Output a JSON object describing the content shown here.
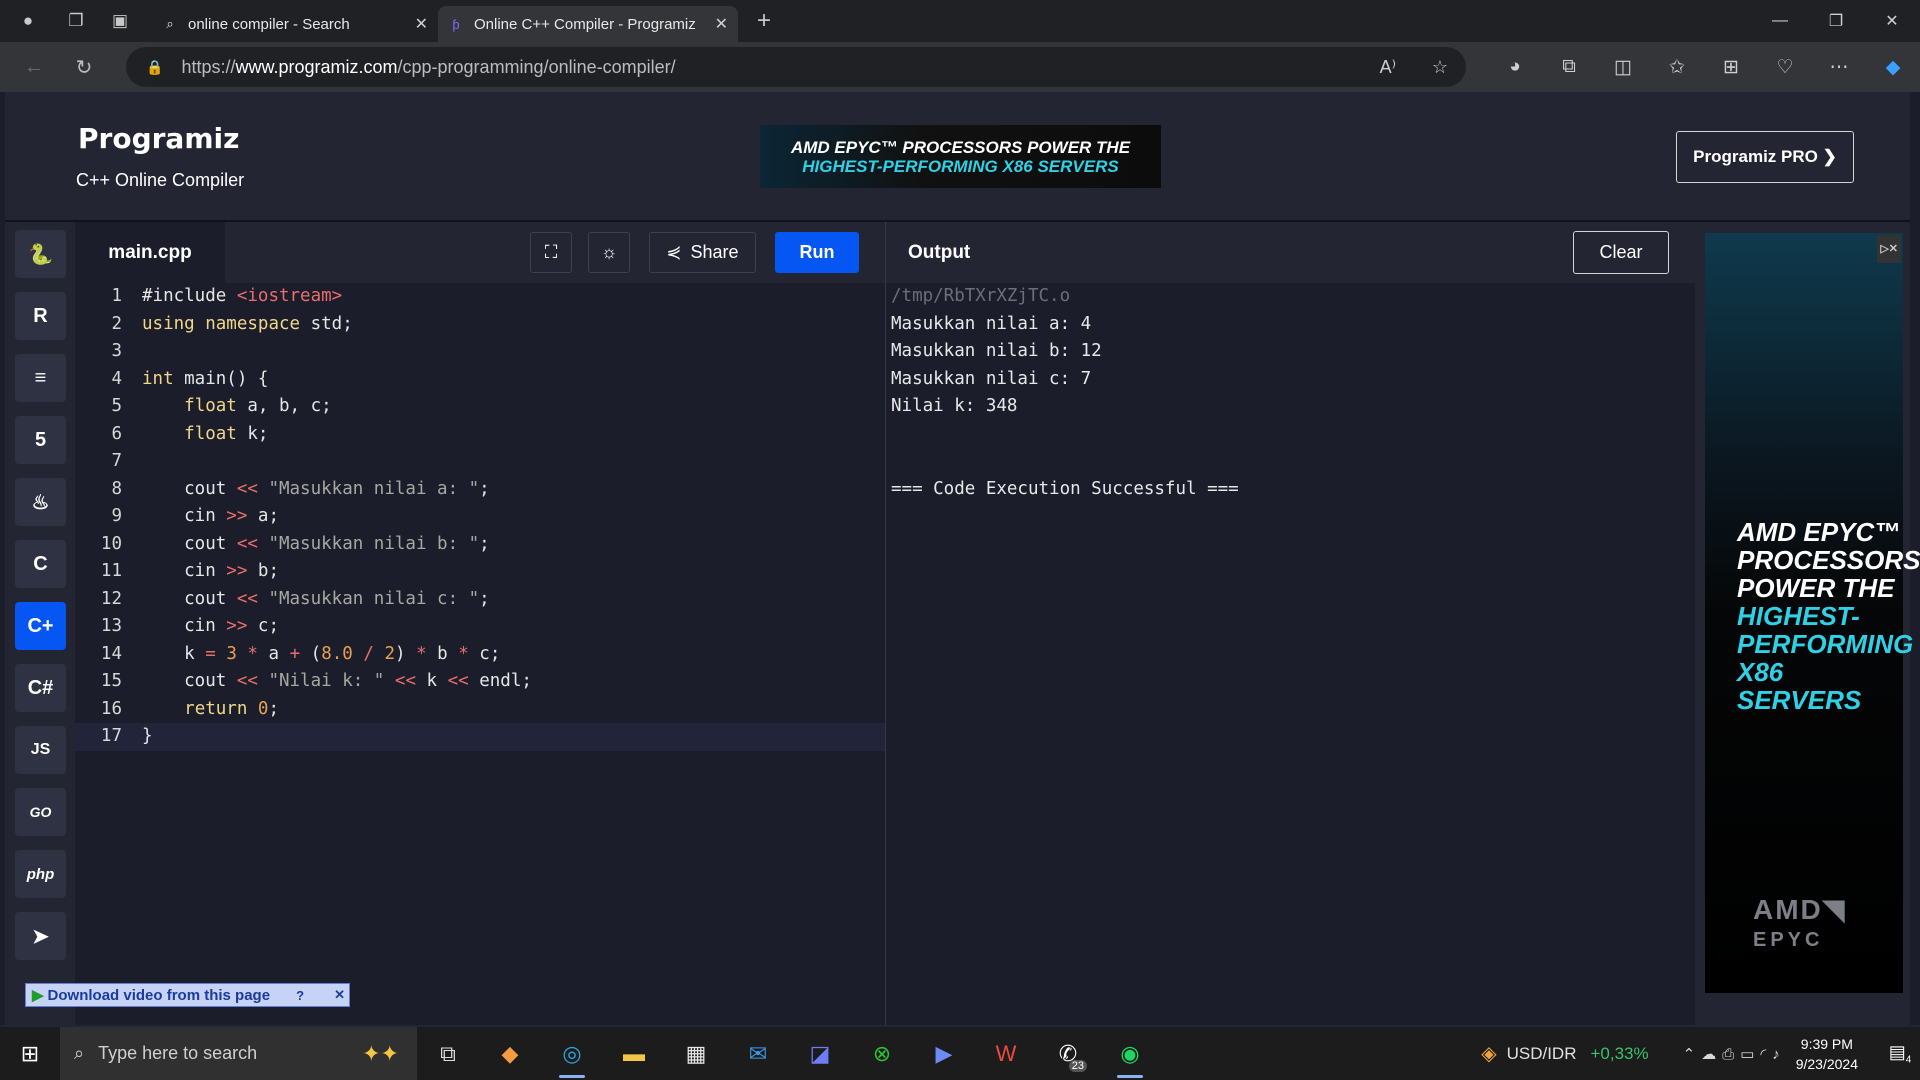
{
  "browser": {
    "tabs": [
      {
        "title": "online compiler - Search",
        "active": false,
        "icon": "search-icon"
      },
      {
        "title": "Online C++ Compiler - Programiz",
        "active": true,
        "icon": "programiz-favicon"
      }
    ],
    "url_prefix": "https://",
    "url_domain": "www.programiz.com",
    "url_path": "/cpp-programming/online-compiler/",
    "read_aloud_label": "A⁾"
  },
  "header": {
    "logo": "Programiz",
    "subtitle": "C++ Online Compiler",
    "banner_line1": "AMD EPYC™ PROCESSORS POWER THE",
    "banner_line2": "HIGHEST-PERFORMING X86 SERVERS",
    "pro_button": "Programiz PRO ❯"
  },
  "sidebar": {
    "languages": [
      {
        "name": "python",
        "glyph": "🐍"
      },
      {
        "name": "r",
        "glyph": "R"
      },
      {
        "name": "sql",
        "glyph": "≡"
      },
      {
        "name": "html",
        "glyph": "5"
      },
      {
        "name": "java",
        "glyph": "♨"
      },
      {
        "name": "c",
        "glyph": "C"
      },
      {
        "name": "cpp",
        "glyph": "C+",
        "selected": true
      },
      {
        "name": "csharp",
        "glyph": "C#"
      },
      {
        "name": "javascript",
        "glyph": "JS"
      },
      {
        "name": "go",
        "glyph": "GO"
      },
      {
        "name": "php",
        "glyph": "php"
      },
      {
        "name": "swift",
        "glyph": "➤"
      }
    ]
  },
  "editor": {
    "filename": "main.cpp",
    "share_label": "Share",
    "run_label": "Run",
    "lines": [
      {
        "n": "1",
        "code": "#include <iostream>"
      },
      {
        "n": "2",
        "code": "using namespace std;"
      },
      {
        "n": "3",
        "code": ""
      },
      {
        "n": "4",
        "code": "int main() {"
      },
      {
        "n": "5",
        "code": "    float a, b, c;"
      },
      {
        "n": "6",
        "code": "    float k;"
      },
      {
        "n": "7",
        "code": ""
      },
      {
        "n": "8",
        "code": "    cout << \"Masukkan nilai a: \";"
      },
      {
        "n": "9",
        "code": "    cin >> a;"
      },
      {
        "n": "10",
        "code": "    cout << \"Masukkan nilai b: \";"
      },
      {
        "n": "11",
        "code": "    cin >> b;"
      },
      {
        "n": "12",
        "code": "    cout << \"Masukkan nilai c: \";"
      },
      {
        "n": "13",
        "code": "    cin >> c;"
      },
      {
        "n": "14",
        "code": "    k = 3 * a + (8.0 / 2) * b * c;"
      },
      {
        "n": "15",
        "code": "    cout << \"Nilai k: \" << k << endl;"
      },
      {
        "n": "16",
        "code": "    return 0;"
      },
      {
        "n": "17",
        "code": "}"
      }
    ]
  },
  "output": {
    "title": "Output",
    "clear_label": "Clear",
    "lines": [
      "/tmp/RbTXrXZjTC.o",
      "Masukkan nilai a: 4",
      "Masukkan nilai b: 12",
      "Masukkan nilai c: 7",
      "Nilai k: 348",
      "",
      "",
      "=== Code Execution Successful ==="
    ]
  },
  "side_ad": {
    "line1": "AMD EPYC™",
    "line2": "PROCESSORS",
    "line3": "POWER THE",
    "line4": "HIGHEST-",
    "line5": "PERFORMING",
    "line6": "X86 SERVERS",
    "brand1": "AMD◥",
    "brand2": "EPYC",
    "close": "▷✕"
  },
  "download_bar": {
    "label": "Download video from this page",
    "help": "?",
    "close": "✕"
  },
  "taskbar": {
    "search_placeholder": "Type here to search",
    "fx_label": "USD/IDR",
    "fx_value": "+0,33%",
    "time": "9:39 PM",
    "date": "9/23/2024",
    "whatsapp_badge": "23",
    "notif_badge": "4"
  },
  "colors": {
    "accent": "#0556f3",
    "editor_bg": "#1b1d2b",
    "panel_bg": "#232533",
    "string": "#a8a8a0",
    "number": "#e8a050",
    "operator": "#e86d6d"
  }
}
